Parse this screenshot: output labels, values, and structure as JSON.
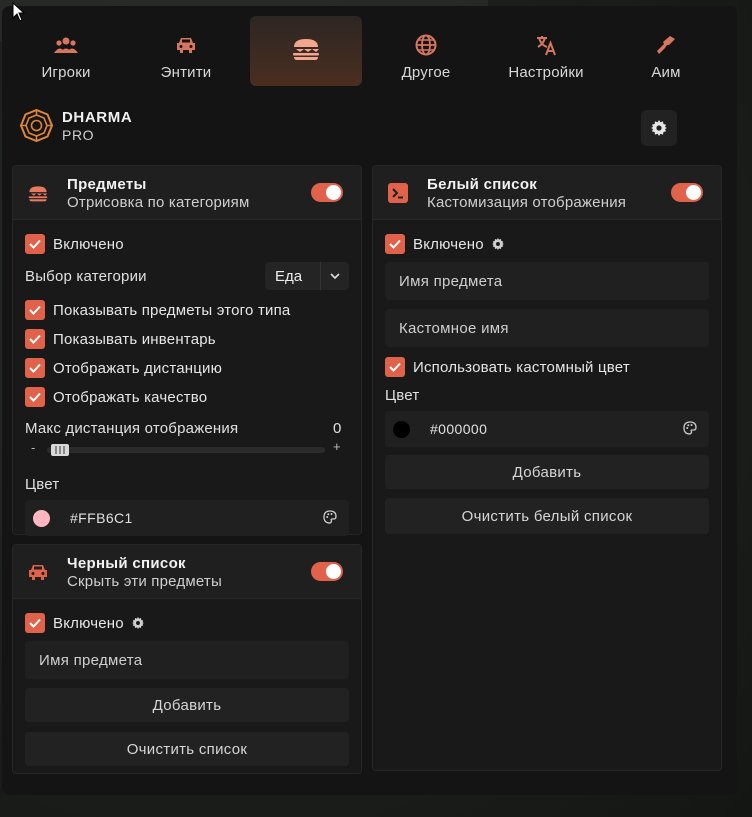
{
  "nav": {
    "tabs": [
      {
        "label": "Игроки",
        "icon": "players-icon"
      },
      {
        "label": "Энтити",
        "icon": "car-icon"
      },
      {
        "label": "",
        "icon": "burger-icon",
        "active": true
      },
      {
        "label": "Другое",
        "icon": "globe-icon"
      },
      {
        "label": "Настройки",
        "icon": "translate-icon"
      },
      {
        "label": "Аим",
        "icon": "gun-icon"
      }
    ]
  },
  "brand": {
    "name": "DHARMA",
    "tier": "PRO"
  },
  "colors": {
    "accent": "#E0624A",
    "panel": "#191919",
    "bg": "#141414"
  },
  "items_panel": {
    "title": "Предметы",
    "subtitle": "Отрисовка по категориям",
    "enabled_label": "Включено",
    "category_label": "Выбор категории",
    "category_value": "Еда",
    "show_type_label": "Показывать предметы этого типа",
    "show_inventory_label": "Показывать инвентарь",
    "show_distance_label": "Отображать дистанцию",
    "show_quality_label": "Отображать качество",
    "max_distance_label": "Макс дистанция отображения",
    "max_distance_value": "0",
    "slider_minus": "-",
    "slider_plus": "+",
    "slider_fraction": 0.0,
    "color_label": "Цвет",
    "color_value": "#FFB6C1"
  },
  "blacklist_panel": {
    "title": "Черный список",
    "subtitle": "Скрыть эти предметы",
    "enabled_label": "Включено",
    "item_placeholder": "Имя предмета",
    "add_label": "Добавить",
    "clear_label": "Очистить список"
  },
  "whitelist_panel": {
    "title": "Белый список",
    "subtitle": "Кастомизация отображения",
    "enabled_label": "Включено",
    "item_placeholder": "Имя предмета",
    "custom_name_placeholder": "Кастомное имя",
    "use_custom_color_label": "Использовать кастомный цвет",
    "color_label": "Цвет",
    "color_value": "#000000",
    "add_label": "Добавить",
    "clear_label": "Очистить белый список"
  }
}
